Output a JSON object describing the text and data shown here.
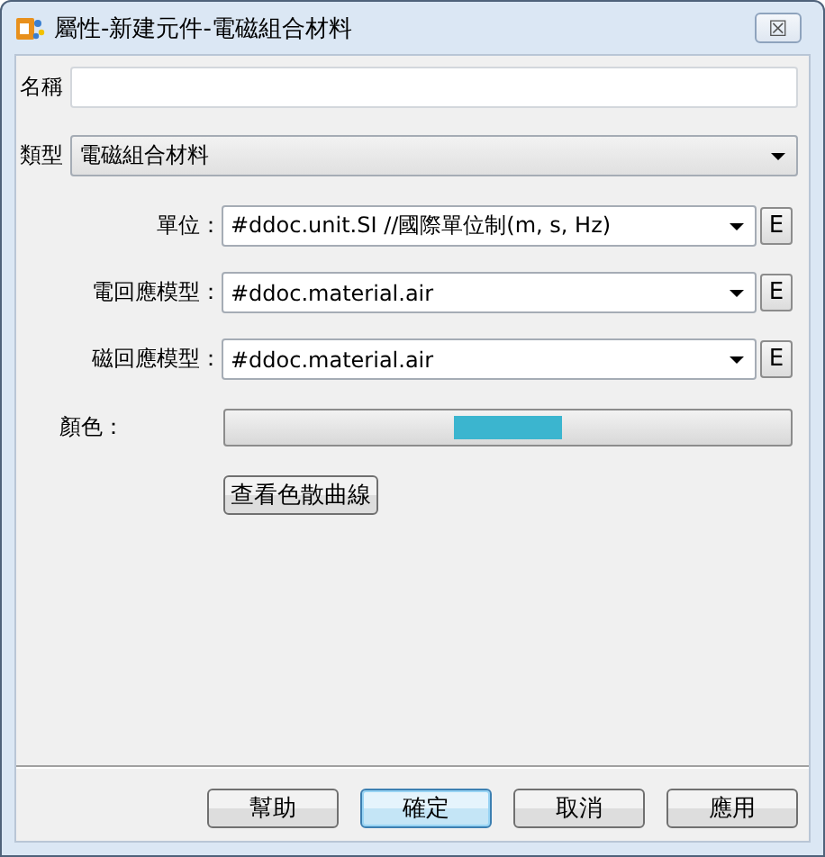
{
  "window": {
    "title": "屬性-新建元件-電磁組合材料",
    "close_symbol": "☒"
  },
  "name_field": {
    "label": "名稱"
  },
  "type_field": {
    "label": "類型",
    "value": "電磁組合材料"
  },
  "properties": [
    {
      "label": "單位：",
      "value": "#ddoc.unit.SI //國際單位制(m, s, Hz)",
      "edit_button": "E"
    },
    {
      "label": "電回應模型：",
      "value": "#ddoc.material.air",
      "edit_button": "E"
    },
    {
      "label": "磁回應模型：",
      "value": "#ddoc.material.air",
      "edit_button": "E"
    }
  ],
  "color_field": {
    "label": "顏色：",
    "color": "#3bb5cf"
  },
  "dispersion_button": "查看色散曲線",
  "buttons": [
    {
      "label": "幫助",
      "focused": false
    },
    {
      "label": "確定",
      "focused": true
    },
    {
      "label": "取消",
      "focused": false
    },
    {
      "label": "應用",
      "focused": false
    }
  ]
}
